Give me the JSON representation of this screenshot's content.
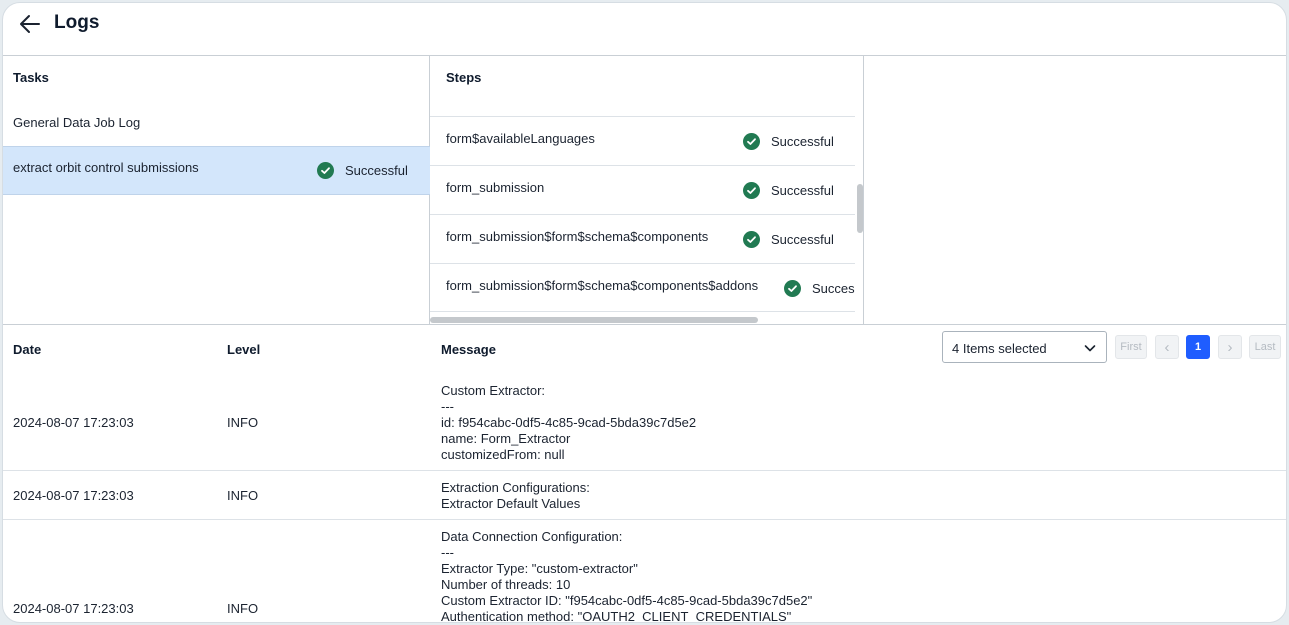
{
  "header": {
    "title": "Logs"
  },
  "tasks": {
    "heading": "Tasks",
    "items": [
      {
        "label": "General Data Job Log",
        "status": ""
      },
      {
        "label": "extract orbit control submissions",
        "status": "Successful"
      }
    ]
  },
  "steps": {
    "heading": "Steps",
    "items": [
      {
        "label": "form$availableLanguages",
        "status": "Successful"
      },
      {
        "label": "form_submission",
        "status": "Successful"
      },
      {
        "label": "form_submission$form$schema$components",
        "status": "Successful"
      },
      {
        "label": "form_submission$form$schema$components$addons",
        "status": "Succes"
      }
    ]
  },
  "log_table": {
    "columns": {
      "date": "Date",
      "level": "Level",
      "message": "Message"
    },
    "filter": {
      "selected": "4 Items selected"
    },
    "pagination": {
      "first": "First",
      "prev": "‹",
      "page": "1",
      "next": "›",
      "last": "Last"
    },
    "rows": [
      {
        "date": "2024-08-07 17:23:03",
        "level": "INFO",
        "message": [
          "Custom Extractor:",
          "---",
          "id: f954cabc-0df5-4c85-9cad-5bda39c7d5e2",
          "name: Form_Extractor",
          "customizedFrom: null"
        ]
      },
      {
        "date": "2024-08-07 17:23:03",
        "level": "INFO",
        "message": [
          "Extraction Configurations:",
          "Extractor Default Values"
        ]
      },
      {
        "date": "2024-08-07 17:23:03",
        "level": "INFO",
        "message": [
          "Data Connection Configuration:",
          "---",
          "Extractor Type: \"custom-extractor\"",
          "Number of threads: 10",
          "Custom Extractor ID: \"f954cabc-0df5-4c85-9cad-5bda39c7d5e2\"",
          "Authentication method: \"OAUTH2_CLIENT_CREDENTIALS\""
        ]
      }
    ]
  },
  "colors": {
    "success": "#217a52",
    "selected_row": "#d3e6fb",
    "active_page": "#1f5dff"
  }
}
